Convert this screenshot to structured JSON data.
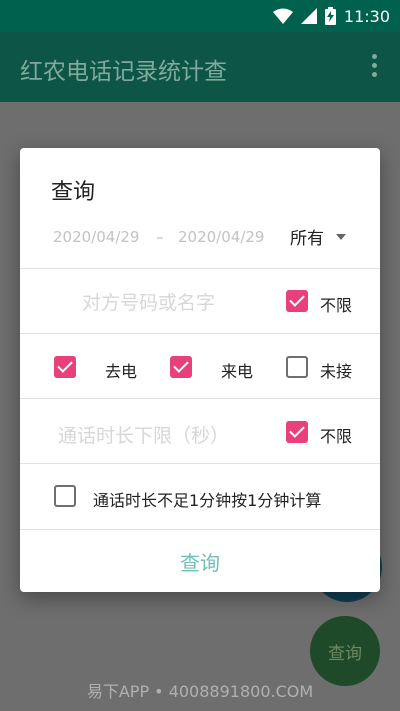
{
  "status_bar": {
    "time": "11:30"
  },
  "app_bar": {
    "title": "红农电话记录统计查"
  },
  "dialog": {
    "title": "查询",
    "date_from": "2020/04/29",
    "date_separator": "–",
    "date_to": "2020/04/29",
    "filter_select": "所有",
    "contact": {
      "placeholder": "对方号码或名字",
      "unlimited_label": "不限",
      "unlimited_checked": true
    },
    "call_types": [
      {
        "label": "去电",
        "checked": true
      },
      {
        "label": "来电",
        "checked": true
      },
      {
        "label": "未接",
        "checked": false
      }
    ],
    "duration": {
      "placeholder": "通话时长下限（秒）",
      "unlimited_label": "不限",
      "unlimited_checked": true
    },
    "round_up": {
      "label": "通话时长不足1分钟按1分钟计算",
      "checked": false
    },
    "query_button": "查询"
  },
  "fab": {
    "label": "查询"
  },
  "footer": {
    "text": "易下APP • 4008891800.COM"
  },
  "colors": {
    "primary_dark": "#0d5545",
    "accent": "#e8407a",
    "button_text": "#6fbfb7"
  }
}
